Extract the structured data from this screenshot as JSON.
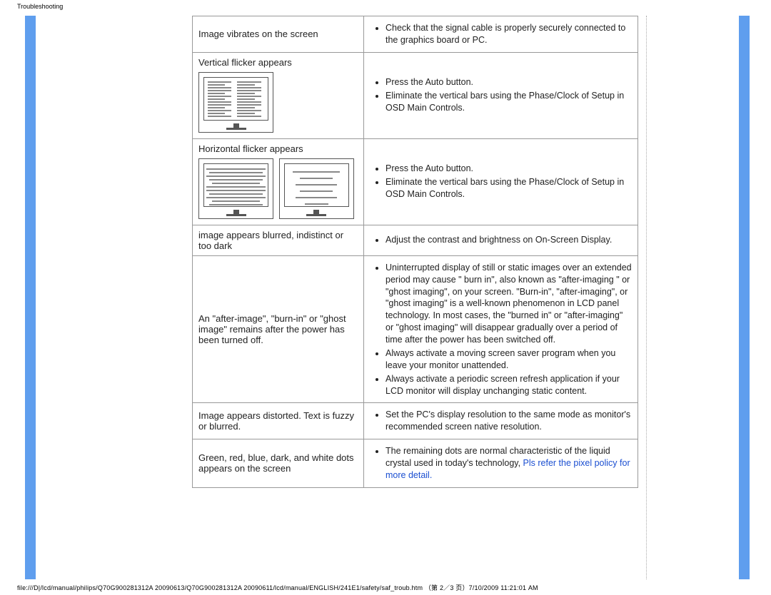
{
  "header": {
    "title": "Troubleshooting"
  },
  "rows": [
    {
      "label": "Image vibrates on the screen",
      "items": [
        "Check that the signal cable is properly securely connected to the graphics board or PC."
      ]
    },
    {
      "label": "Vertical flicker appears",
      "items": [
        "Press the Auto button.",
        "Eliminate the vertical bars using the Phase/Clock of Setup in OSD Main Controls."
      ]
    },
    {
      "label": "Horizontal flicker appears",
      "items": [
        "Press the Auto button.",
        "Eliminate the vertical bars using the Phase/Clock of Setup in OSD Main Controls."
      ]
    },
    {
      "label": "image appears blurred, indistinct or too dark",
      "items": [
        "Adjust the contrast and brightness on On-Screen Display."
      ]
    },
    {
      "label": "An \"after-image\", \"burn-in\" or \"ghost image\" remains after the power has been turned off.",
      "items": [
        "Uninterrupted display of still or static images over an extended period may cause \" burn in\", also known as \"after-imaging \" or \"ghost imaging\", on your screen. \"Burn-in\", \"after-imaging\", or \"ghost imaging\" is a well-known phenomenon in LCD panel technology. In most cases, the \"burned in\" or \"after-imaging\" or \"ghost imaging\" will disappear gradually over a period of time after the power has been switched off.",
        "Always activate a moving screen saver program when you leave your monitor unattended.",
        "Always activate a periodic screen refresh application if your LCD monitor will display unchanging static content."
      ]
    },
    {
      "label": "Image appears distorted. Text   is fuzzy or blurred.",
      "items": [
        "Set the PC's display resolution to the same mode as monitor's recommended screen native resolution."
      ]
    },
    {
      "label": "Green, red, blue, dark, and white dots appears on the screen",
      "items_pre": "The remaining dots are normal characteristic of the liquid crystal used in today's technology, ",
      "link": "Pls refer the pixel policy for more detail."
    }
  ],
  "footer": "file:///D|/lcd/manual/philips/Q70G900281312A 20090613/Q70G900281312A 20090611/lcd/manual/ENGLISH/241E1/safety/saf_troub.htm （第 2／3 页）7/10/2009 11:21:01 AM"
}
